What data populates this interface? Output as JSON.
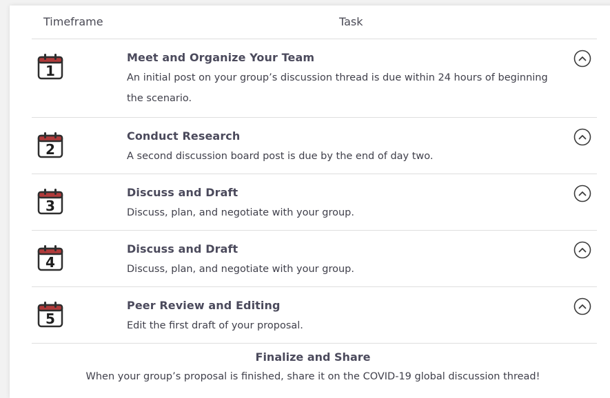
{
  "table": {
    "headers": {
      "timeframe": "Timeframe",
      "task": "Task"
    },
    "rows": [
      {
        "day": "1",
        "title": "Meet and Organize Your Team",
        "description": "An initial post on your group’s discussion thread is due within 24 hours of beginning the scenario.",
        "icon": "calendar-icon"
      },
      {
        "day": "2",
        "title": "Conduct Research",
        "description": "A second discussion board post is due by the end of day two.",
        "icon": "calendar-icon"
      },
      {
        "day": "3",
        "title": "Discuss and Draft",
        "description": "Discuss, plan, and negotiate with your group.",
        "icon": "calendar-icon"
      },
      {
        "day": "4",
        "title": "Discuss and Draft",
        "description": "Discuss, plan, and negotiate with your group.",
        "icon": "calendar-icon"
      },
      {
        "day": "5",
        "title": "Peer Review and Editing",
        "description": "Edit the first draft of your proposal.",
        "icon": "calendar-icon"
      }
    ]
  },
  "final": {
    "title": "Finalize and Share",
    "description": "When your group’s proposal is finished, share it on the COVID-19 global discussion thread!"
  },
  "colors": {
    "calendar_red": "#b03a3a",
    "calendar_dark": "#3a3a3a",
    "title_text": "#4b4a5c",
    "body_text": "#3f3f4a",
    "divider": "#dedede"
  },
  "icons": {
    "toggle": "chevron-up-circle-icon"
  }
}
